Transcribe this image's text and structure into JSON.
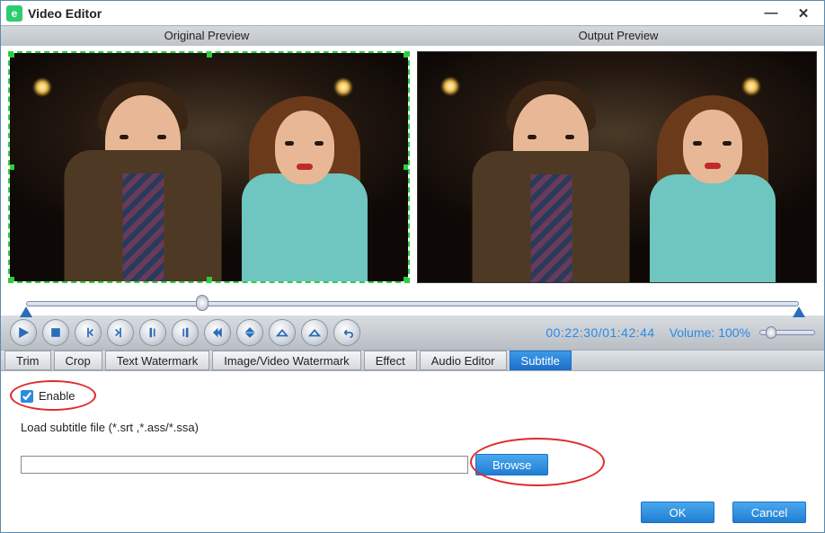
{
  "window": {
    "title": "Video Editor"
  },
  "preview": {
    "original_label": "Original Preview",
    "output_label": "Output Preview"
  },
  "playback": {
    "time_current": "00:22:30",
    "time_total": "01:42:44",
    "volume_label": "Volume:",
    "volume_value": "100%",
    "timeline_position_pct": 22
  },
  "controls": {
    "play": "play",
    "stop": "stop",
    "step_back": "step-back",
    "step_fwd": "step-forward",
    "mark_in": "mark-in",
    "mark_out": "mark-out",
    "goto_in": "goto-in",
    "goto_out": "goto-out",
    "flip_h": "flip-horizontal",
    "flip_v": "flip-vertical",
    "undo": "undo"
  },
  "tabs": [
    {
      "id": "trim",
      "label": "Trim",
      "active": false
    },
    {
      "id": "crop",
      "label": "Crop",
      "active": false
    },
    {
      "id": "text-watermark",
      "label": "Text Watermark",
      "active": false
    },
    {
      "id": "image-watermark",
      "label": "Image/Video Watermark",
      "active": false
    },
    {
      "id": "effect",
      "label": "Effect",
      "active": false
    },
    {
      "id": "audio-editor",
      "label": "Audio Editor",
      "active": false
    },
    {
      "id": "subtitle",
      "label": "Subtitle",
      "active": true
    }
  ],
  "subtitle_panel": {
    "enable_label": "Enable",
    "enable_checked": true,
    "load_label": "Load subtitle file (*.srt ,*.ass/*.ssa)",
    "file_path": "",
    "browse_label": "Browse"
  },
  "footer": {
    "ok": "OK",
    "cancel": "Cancel"
  },
  "annotations": {
    "highlight_enable": true,
    "highlight_browse": true
  }
}
